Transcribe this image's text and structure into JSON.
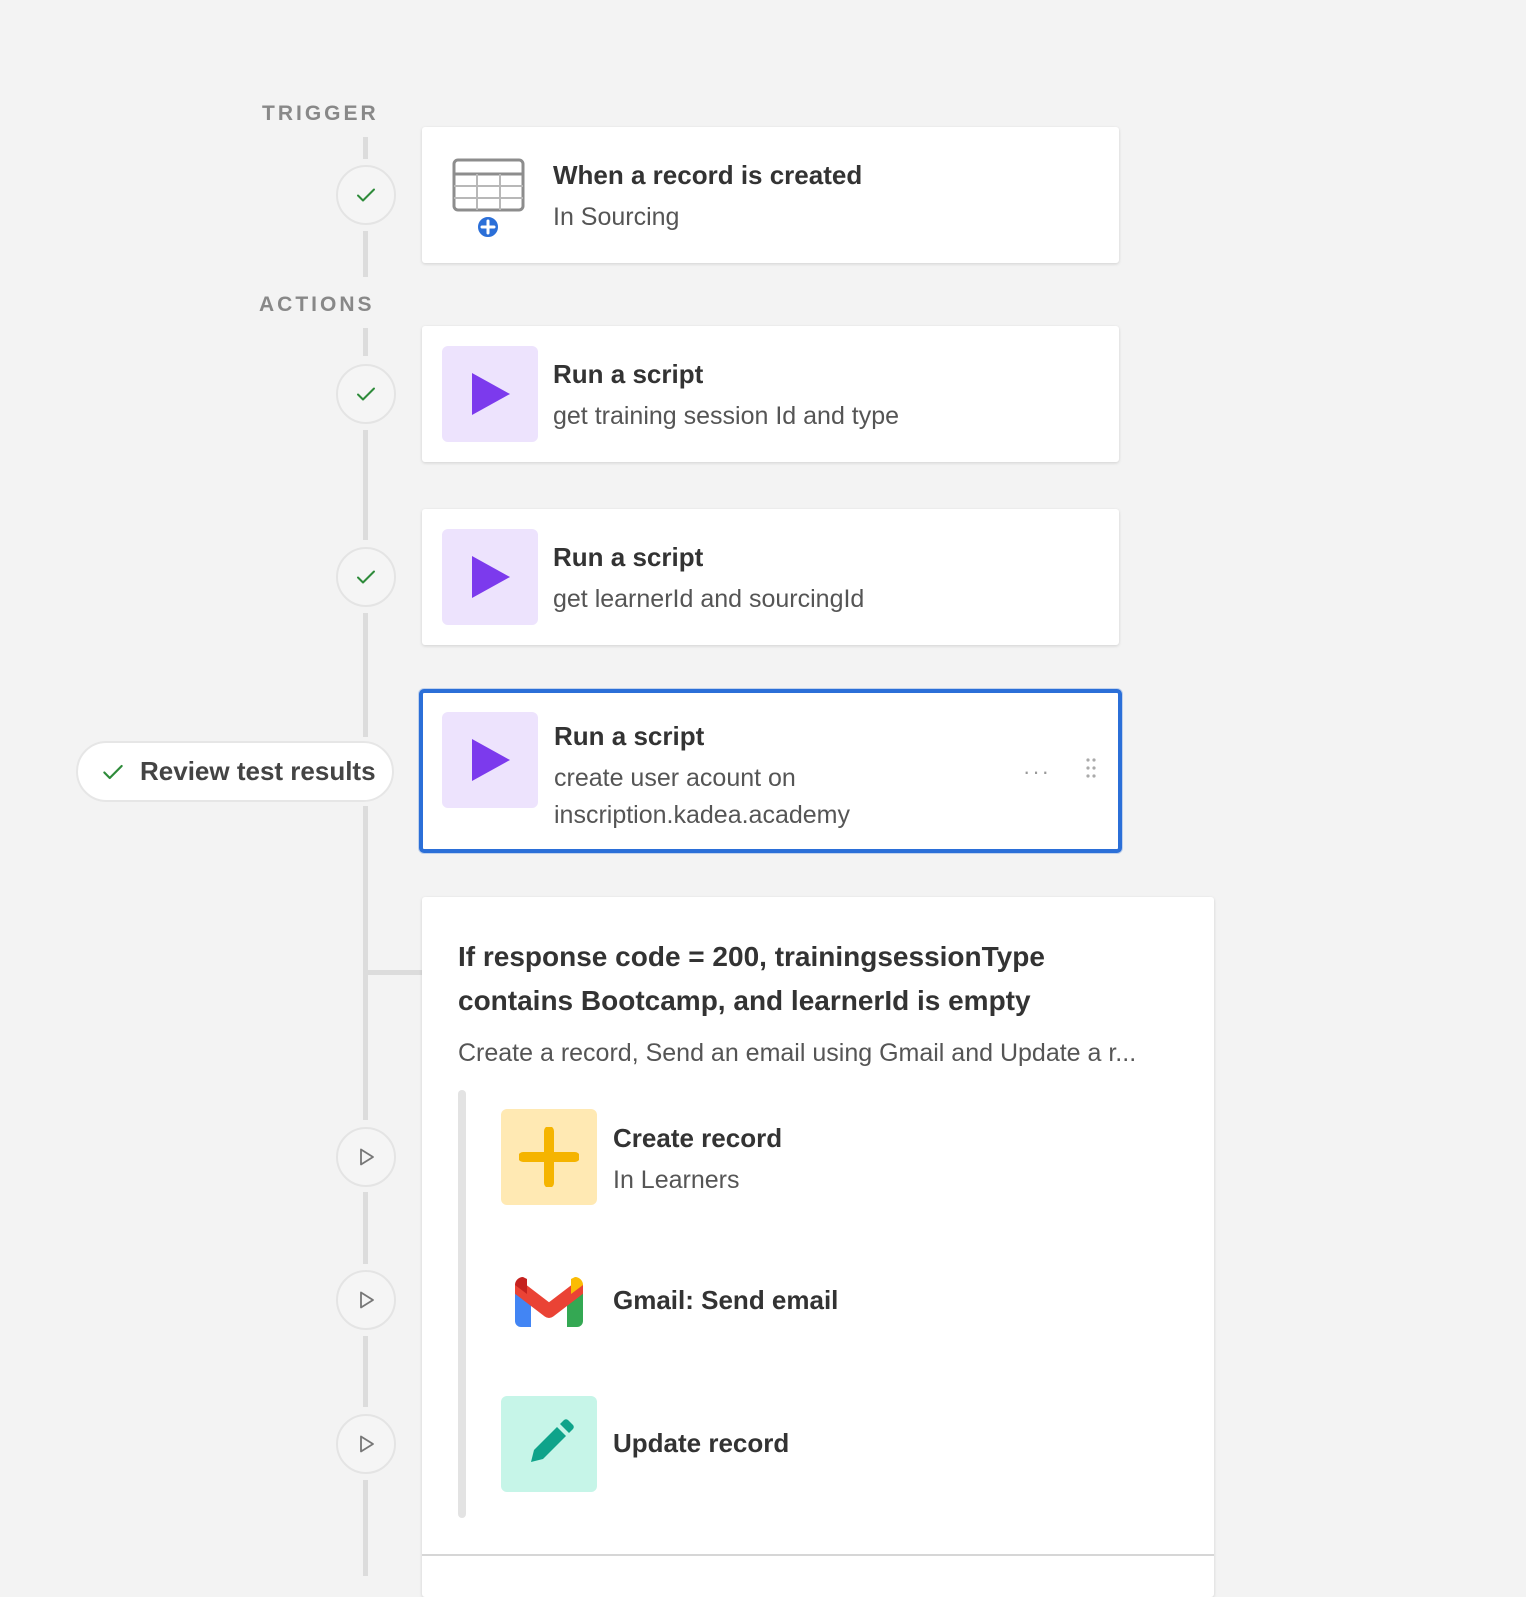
{
  "sections": {
    "trigger_label": "TRIGGER",
    "actions_label": "ACTIONS"
  },
  "trigger": {
    "title": "When a record is created",
    "subtitle": "In Sourcing",
    "icon": "table-add-icon",
    "status": "success"
  },
  "actions": [
    {
      "title": "Run a script",
      "subtitle": "get training session Id and type",
      "icon": "play-icon",
      "status": "success"
    },
    {
      "title": "Run a script",
      "subtitle": "get learnerId and sourcingId",
      "icon": "play-icon",
      "status": "success"
    },
    {
      "title": "Run a script",
      "subtitle_line1": "create user acount on",
      "subtitle_line2": "inscription.kadea.academy",
      "icon": "play-icon",
      "status": "selected"
    }
  ],
  "review": {
    "label": "Review test results",
    "icon": "check-icon"
  },
  "menu": {
    "dots": "···"
  },
  "condition": {
    "title": "If response code = 200, trainingsessionType contains Bootcamp, and learnerId is empty",
    "description": "Create a record, Send an email using Gmail and Update a r...",
    "steps": [
      {
        "title": "Create record",
        "subtitle": "In Learners",
        "icon": "plus-icon"
      },
      {
        "title": "Gmail: Send email",
        "icon": "gmail-icon"
      },
      {
        "title": "Update record",
        "icon": "pencil-icon"
      }
    ]
  },
  "colors": {
    "accent_blue": "#2b6fd8",
    "purple_play": "#7c3aed",
    "success_green": "#2e8b3a",
    "yellow_plus": "#f5b400",
    "teal_pencil": "#0fa38a"
  }
}
